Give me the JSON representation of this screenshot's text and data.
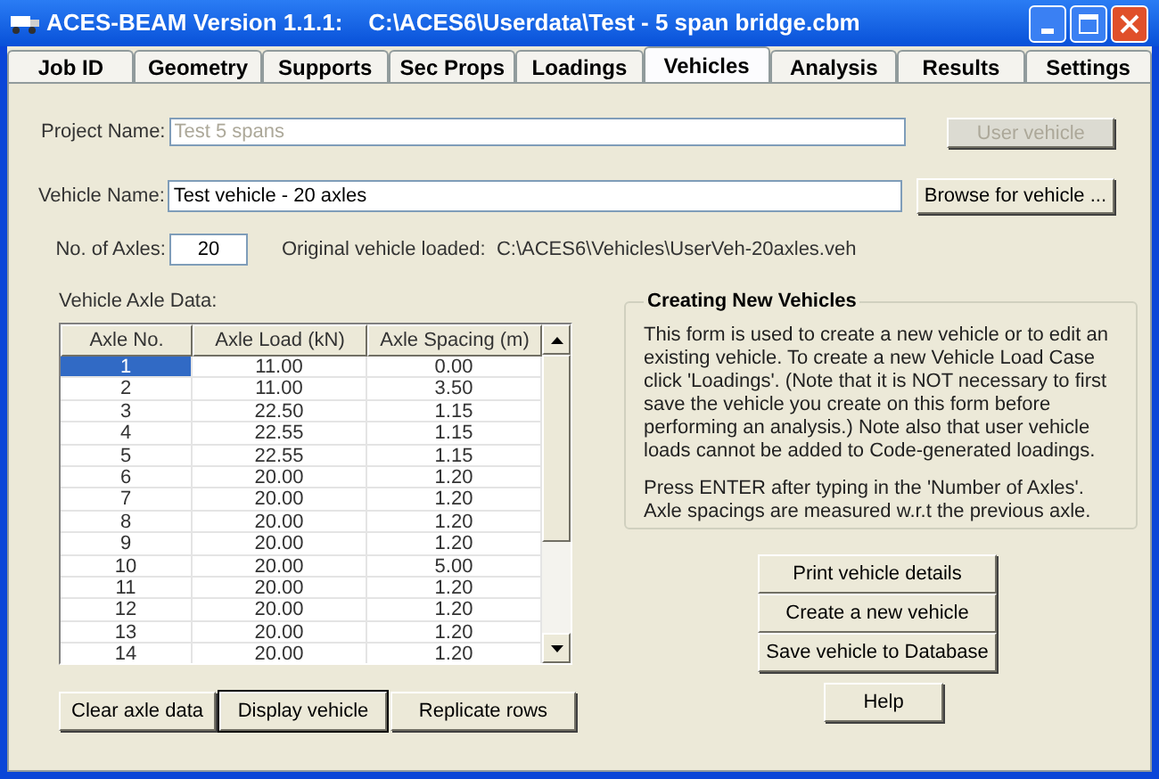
{
  "window": {
    "title": "ACES-BEAM Version 1.1.1:    C:\\ACES6\\Userdata\\Test - 5 span bridge.cbm"
  },
  "tabs": [
    {
      "label": "Job ID",
      "selected": false
    },
    {
      "label": "Geometry",
      "selected": false
    },
    {
      "label": "Supports",
      "selected": false
    },
    {
      "label": "Sec Props",
      "selected": false
    },
    {
      "label": "Loadings",
      "selected": false
    },
    {
      "label": "Vehicles",
      "selected": true
    },
    {
      "label": "Analysis",
      "selected": false
    },
    {
      "label": "Results",
      "selected": false
    },
    {
      "label": "Settings",
      "selected": false
    }
  ],
  "project_name": {
    "label": "Project Name:",
    "value": "Test 5 spans",
    "disabled": true
  },
  "user_vehicle_button": {
    "label": "User vehicle",
    "disabled": true
  },
  "vehicle_name": {
    "label": "Vehicle Name:",
    "value": "Test vehicle - 20 axles"
  },
  "browse_button": {
    "label": "Browse for vehicle ..."
  },
  "axles": {
    "label": "No. of Axles:",
    "value": "20"
  },
  "original_vehicle": "Original vehicle loaded:  C:\\ACES6\\Vehicles\\UserVeh-20axles.veh",
  "table": {
    "label": "Vehicle Axle Data:",
    "columns": [
      "Axle No.",
      "Axle Load  (kN)",
      "Axle Spacing  (m)"
    ],
    "rows": [
      {
        "cells": [
          "1",
          "11.00",
          "0.00"
        ],
        "selected": true
      },
      {
        "cells": [
          "2",
          "11.00",
          "3.50"
        ],
        "selected": false
      },
      {
        "cells": [
          "3",
          "22.50",
          "1.15"
        ],
        "selected": false
      },
      {
        "cells": [
          "4",
          "22.55",
          "1.15"
        ],
        "selected": false
      },
      {
        "cells": [
          "5",
          "22.55",
          "1.15"
        ],
        "selected": false
      },
      {
        "cells": [
          "6",
          "20.00",
          "1.20"
        ],
        "selected": false
      },
      {
        "cells": [
          "7",
          "20.00",
          "1.20"
        ],
        "selected": false
      },
      {
        "cells": [
          "8",
          "20.00",
          "1.20"
        ],
        "selected": false
      },
      {
        "cells": [
          "9",
          "20.00",
          "1.20"
        ],
        "selected": false
      },
      {
        "cells": [
          "10",
          "20.00",
          "5.00"
        ],
        "selected": false
      },
      {
        "cells": [
          "11",
          "20.00",
          "1.20"
        ],
        "selected": false
      },
      {
        "cells": [
          "12",
          "20.00",
          "1.20"
        ],
        "selected": false
      },
      {
        "cells": [
          "13",
          "20.00",
          "1.20"
        ],
        "selected": false
      },
      {
        "cells": [
          "14",
          "20.00",
          "1.20"
        ],
        "selected": false
      }
    ]
  },
  "table_buttons": [
    {
      "label": "Clear axle data",
      "focused": false
    },
    {
      "label": "Display vehicle",
      "focused": true
    },
    {
      "label": "Replicate rows",
      "focused": false
    }
  ],
  "info_box": {
    "title": "Creating New Vehicles",
    "paragraphs": [
      "This form is used to create a new vehicle or to edit an existing vehicle. To create a new Vehicle Load Case click 'Loadings'.  (Note that it is NOT necessary to  first save the vehicle you create on this form before performing an analysis.)  Note also that user vehicle loads cannot be added to Code-generated loadings.",
      "Press ENTER after typing in the 'Number of Axles'. Axle spacings are measured w.r.t the previous axle."
    ]
  },
  "action_buttons": [
    "Print vehicle details",
    "Create a new vehicle",
    "Save vehicle to Database"
  ],
  "help_button": "Help"
}
